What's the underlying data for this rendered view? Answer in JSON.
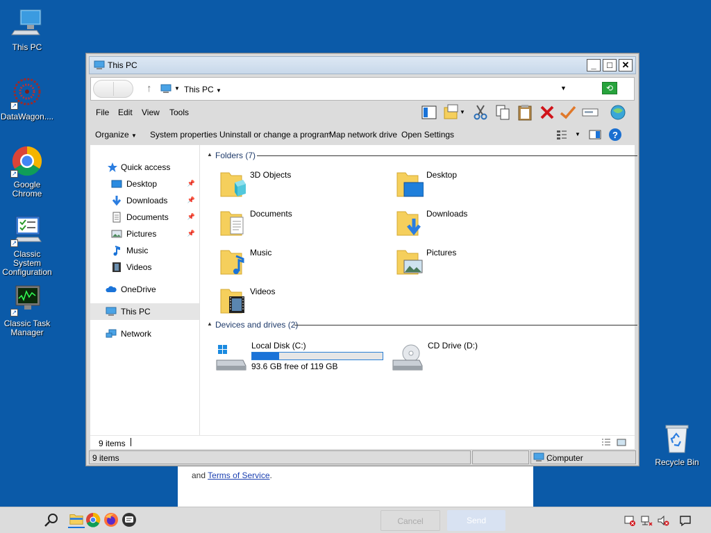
{
  "desktop": {
    "icons": [
      {
        "label": "This PC"
      },
      {
        "label": "DataWagon...."
      },
      {
        "label": "Google Chrome"
      },
      {
        "label": "Classic System Configuration"
      },
      {
        "label": "Classic Task Manager"
      },
      {
        "label": "Recycle Bin"
      }
    ]
  },
  "web_popup": {
    "text_prefix": "and ",
    "link": "Terms of Service",
    "text_suffix": ".",
    "cancel": "Cancel",
    "send": "Send"
  },
  "window": {
    "title": "This PC",
    "address": "This PC",
    "menu": [
      "File",
      "Edit",
      "View",
      "Tools"
    ],
    "commands": [
      "Organize",
      "System properties",
      "Uninstall or change a program",
      "Map network drive",
      "Open Settings"
    ],
    "nav": {
      "quick_access": "Quick access",
      "items": [
        {
          "label": "Desktop",
          "pinned": true
        },
        {
          "label": "Downloads",
          "pinned": true
        },
        {
          "label": "Documents",
          "pinned": true
        },
        {
          "label": "Pictures",
          "pinned": true
        },
        {
          "label": "Music",
          "pinned": false
        },
        {
          "label": "Videos",
          "pinned": false
        }
      ],
      "onedrive": "OneDrive",
      "this_pc": "This PC",
      "network": "Network"
    },
    "folders_header": "Folders (7)",
    "folders": [
      "3D Objects",
      "Desktop",
      "Documents",
      "Downloads",
      "Music",
      "Pictures",
      "Videos"
    ],
    "drives_header": "Devices and drives (2)",
    "drives": [
      {
        "label": "Local Disk (C:)",
        "free": "93.6 GB free of 119 GB",
        "used_fraction": 0.21
      },
      {
        "label": "CD Drive (D:)"
      }
    ],
    "info_items": "9 items",
    "status_items": "9 items",
    "status_location": "Computer"
  },
  "colors": {
    "desktop": "#0b5aa8",
    "drive_bar": "#1a73d8",
    "folder_yellow": "#f5cf5c"
  }
}
